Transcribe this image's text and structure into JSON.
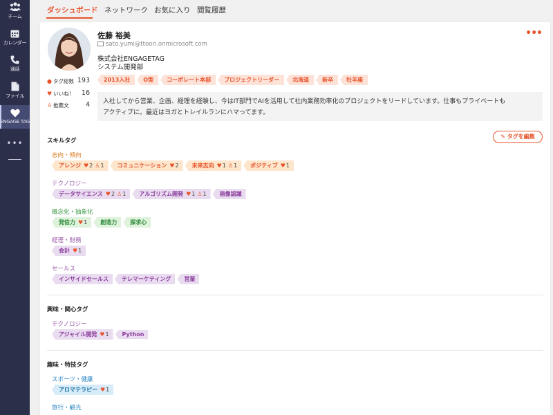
{
  "sidebar": {
    "items": [
      {
        "label": "チーム",
        "icon": "team-icon"
      },
      {
        "label": "カレンダー",
        "icon": "calendar-icon"
      },
      {
        "label": "通話",
        "icon": "phone-icon"
      },
      {
        "label": "ファイル",
        "icon": "file-icon"
      },
      {
        "label": "ENGAGE TAG",
        "icon": "engage-tag-icon"
      }
    ],
    "more": "•••"
  },
  "tabs": [
    "ダッシュボード",
    "ネットワーク",
    "お気に入り",
    "閲覧履歴"
  ],
  "profile": {
    "name": "佐藤 裕美",
    "email": "sato.yumi@ttoori.onmicrosoft.com",
    "company": "株式会社ENGAGETAG",
    "department": "システム開発部",
    "stats": [
      {
        "label": "タグ総数",
        "value": "193"
      },
      {
        "label": "いいね！",
        "value": "16"
      },
      {
        "label": "推薦文",
        "value": "4"
      }
    ],
    "tags": [
      "2013入社",
      "O型",
      "コーポレート本部",
      "プロジェクトリーダー",
      "北海道",
      "新卒",
      "牡羊座"
    ],
    "bio_line1": "入社してから営業、企画、経理を経験し、今はIT部門でAIを活用して社内業務効率化のプロジェクトをリードしています。仕事もプライベートも",
    "bio_line2": "アクティブに。最近はヨガとトレイルランにハマってます。",
    "more_menu": "•••"
  },
  "skills": {
    "title": "スキルタグ",
    "edit_label": "タグを編集",
    "categories": [
      {
        "name": "志向・傾向",
        "tags": [
          {
            "label": "アレンジ",
            "likes": "2",
            "recs": "1"
          },
          {
            "label": "コミュニケーション",
            "likes": "2"
          },
          {
            "label": "未来志向",
            "likes": "1",
            "recs": "1"
          },
          {
            "label": "ポジティブ",
            "likes": "1"
          }
        ]
      },
      {
        "name": "テクノロジー",
        "tags": [
          {
            "label": "データサイエンス",
            "likes": "2",
            "recs": "1"
          },
          {
            "label": "アルゴリズム開発",
            "likes": "1",
            "recs": "1"
          },
          {
            "label": "画像認識"
          }
        ]
      },
      {
        "name": "概念化・抽象化",
        "tags": [
          {
            "label": "発信力",
            "likes": "1"
          },
          {
            "label": "創造力"
          },
          {
            "label": "探求心"
          }
        ]
      },
      {
        "name": "経理・財務",
        "tags": [
          {
            "label": "会計",
            "likes": "1"
          }
        ]
      },
      {
        "name": "セールス",
        "tags": [
          {
            "label": "インサイドセールス"
          },
          {
            "label": "テレマーケティング"
          },
          {
            "label": "営業"
          }
        ]
      }
    ]
  },
  "interests": {
    "title": "興味・関心タグ",
    "categories": [
      {
        "name": "テクノロジー",
        "tags": [
          {
            "label": "アジャイル開発",
            "likes": "1"
          },
          {
            "label": "Python"
          }
        ]
      }
    ]
  },
  "hobbies": {
    "title": "趣味・特技タグ",
    "categories": [
      {
        "name": "スポーツ・健康",
        "tags": [
          {
            "label": "アロマテラピー",
            "likes": "1"
          }
        ]
      },
      {
        "name": "旅行・観光",
        "tags": []
      }
    ]
  }
}
